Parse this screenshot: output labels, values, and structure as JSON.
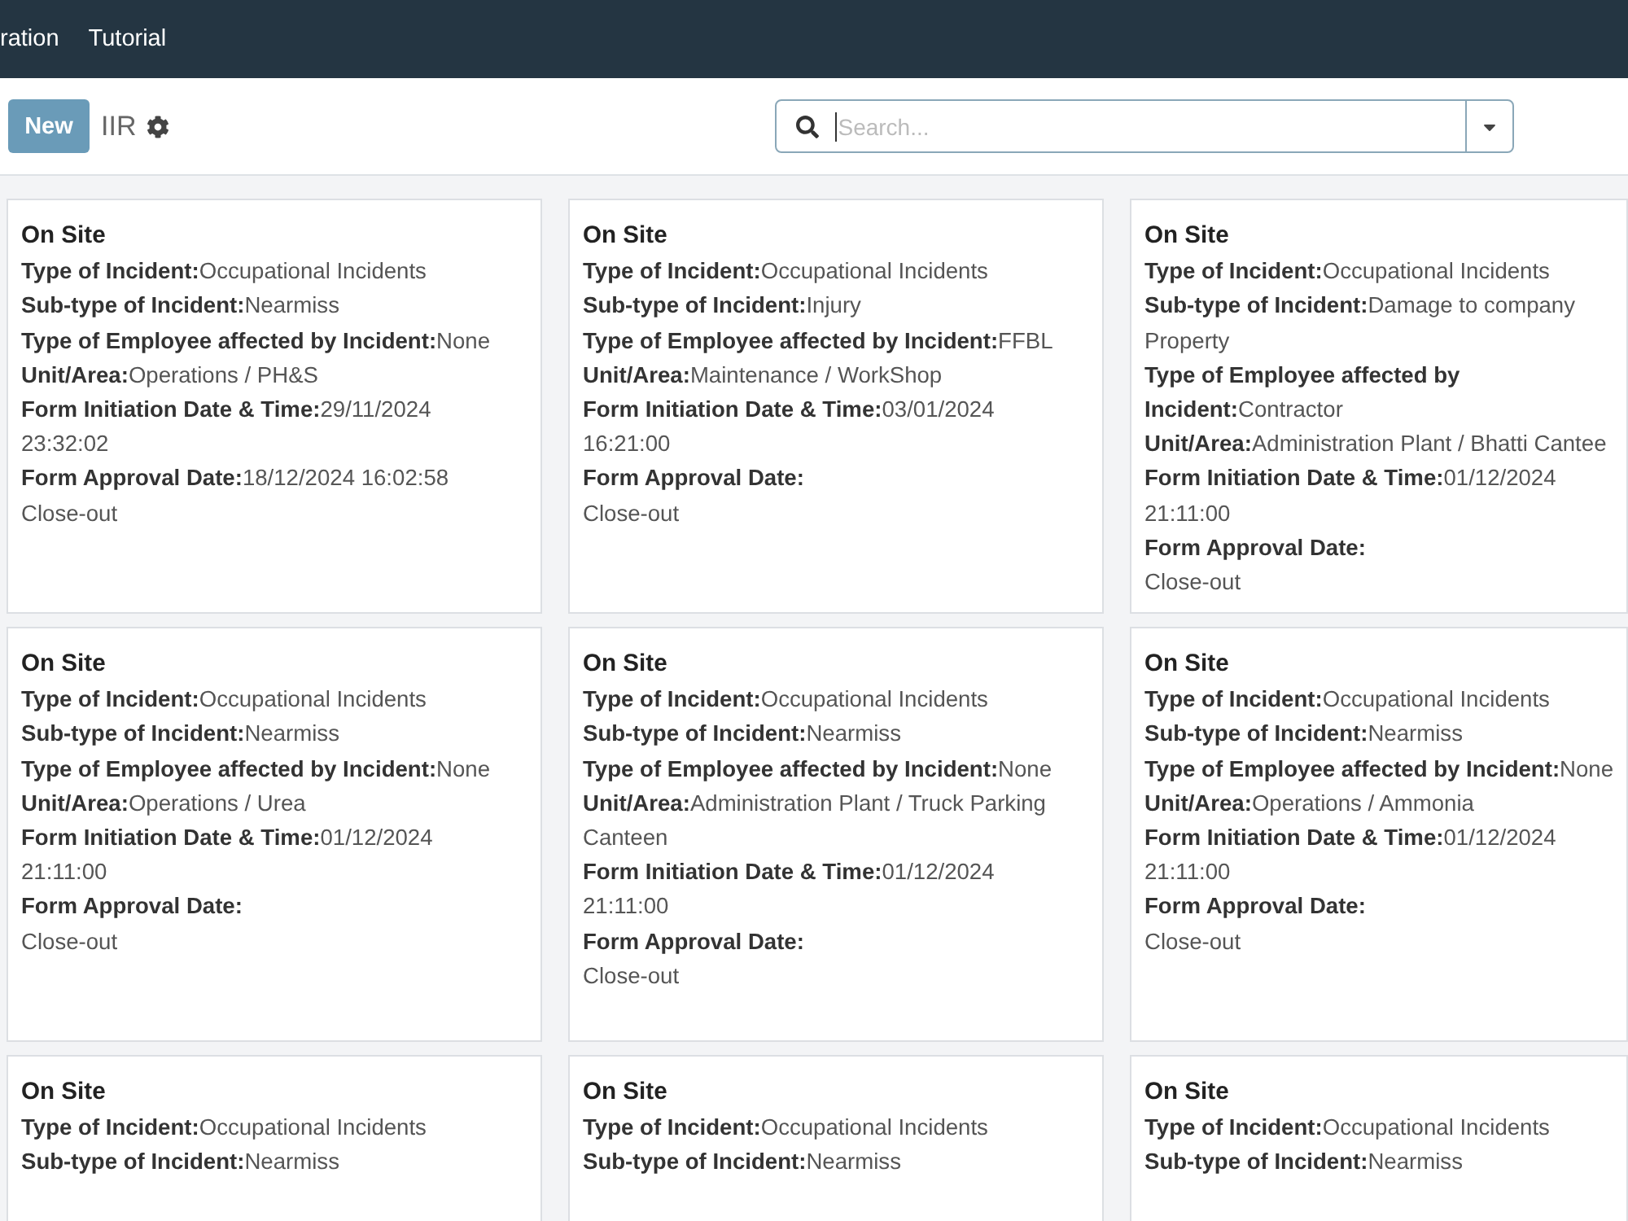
{
  "navbar": {
    "items": [
      {
        "label": "ration"
      },
      {
        "label": "Tutorial"
      }
    ]
  },
  "toolbar": {
    "new_button": "New",
    "breadcrumb": "IIR",
    "search": {
      "placeholder": "Search..."
    }
  },
  "cards": [
    {
      "title": "On Site",
      "fields": [
        {
          "label": "Type of Incident:",
          "value": "Occupational Incidents"
        },
        {
          "label": "Sub-type of Incident:",
          "value": "Nearmiss"
        },
        {
          "label": "Type of Employee affected by Incident:",
          "value": "None"
        },
        {
          "label": "Unit/Area:",
          "value": "Operations / PH&S"
        },
        {
          "label": "Form Initiation Date & Time:",
          "value": "29/11/2024 23:32:02"
        },
        {
          "label": "Form Approval Date:",
          "value": "18/12/2024 16:02:58"
        }
      ],
      "status": "Close-out"
    },
    {
      "title": "On Site",
      "fields": [
        {
          "label": "Type of Incident:",
          "value": "Occupational Incidents"
        },
        {
          "label": "Sub-type of Incident:",
          "value": "Injury"
        },
        {
          "label": "Type of Employee affected by Incident:",
          "value": "FFBL"
        },
        {
          "label": "Unit/Area:",
          "value": "Maintenance / WorkShop"
        },
        {
          "label": "Form Initiation Date & Time:",
          "value": "03/01/2024 16:21:00"
        },
        {
          "label": "Form Approval Date:"
        }
      ],
      "status": "Close-out"
    },
    {
      "title": "On Site",
      "fields": [
        {
          "label": "Type of Incident:",
          "value": "Occupational Incidents"
        },
        {
          "label": "Sub-type of Incident:",
          "value": "Damage to company Property"
        },
        {
          "label": "Type of Employee affected by Incident:",
          "value": "Contractor"
        },
        {
          "label": "Unit/Area:",
          "value": "Administration Plant / Bhatti Cantee"
        },
        {
          "label": "Form Initiation Date & Time:",
          "value": "01/12/2024 21:11:00"
        },
        {
          "label": "Form Approval Date:"
        }
      ],
      "status": "Close-out"
    },
    {
      "title": "On Site",
      "fields": [
        {
          "label": "Type of Incident:",
          "value": "Occupational Incidents"
        },
        {
          "label": "Sub-type of Incident:",
          "value": "Nearmiss"
        },
        {
          "label": "Type of Employee affected by Incident:",
          "value": "None"
        },
        {
          "label": "Unit/Area:",
          "value": "Operations / Urea"
        },
        {
          "label": "Form Initiation Date & Time:",
          "value": "01/12/2024 21:11:00"
        },
        {
          "label": "Form Approval Date:"
        }
      ],
      "status": "Close-out"
    },
    {
      "title": "On Site",
      "fields": [
        {
          "label": "Type of Incident:",
          "value": "Occupational Incidents"
        },
        {
          "label": "Sub-type of Incident:",
          "value": "Nearmiss"
        },
        {
          "label": "Type of Employee affected by Incident:",
          "value": "None"
        },
        {
          "label": "Unit/Area:",
          "value": "Administration Plant / Truck Parking Canteen"
        },
        {
          "label": "Form Initiation Date & Time:",
          "value": "01/12/2024 21:11:00"
        },
        {
          "label": "Form Approval Date:"
        }
      ],
      "status": "Close-out"
    },
    {
      "title": "On Site",
      "fields": [
        {
          "label": "Type of Incident:",
          "value": "Occupational Incidents"
        },
        {
          "label": "Sub-type of Incident:",
          "value": "Nearmiss"
        },
        {
          "label": "Type of Employee affected by Incident:",
          "value": "None"
        },
        {
          "label": "Unit/Area:",
          "value": "Operations / Ammonia"
        },
        {
          "label": "Form Initiation Date & Time:",
          "value": "01/12/2024 21:11:00"
        },
        {
          "label": "Form Approval Date:"
        }
      ],
      "status": "Close-out"
    },
    {
      "title": "On Site",
      "fields": [
        {
          "label": "Type of Incident:",
          "value": "Occupational Incidents"
        },
        {
          "label": "Sub-type of Incident:",
          "value": "Nearmiss"
        }
      ]
    },
    {
      "title": "On Site",
      "fields": [
        {
          "label": "Type of Incident:",
          "value": "Occupational Incidents"
        },
        {
          "label": "Sub-type of Incident:",
          "value": "Nearmiss"
        }
      ]
    },
    {
      "title": "On Site",
      "fields": [
        {
          "label": "Type of Incident:",
          "value": "Occupational Incidents"
        },
        {
          "label": "Sub-type of Incident:",
          "value": "Nearmiss"
        }
      ]
    }
  ]
}
